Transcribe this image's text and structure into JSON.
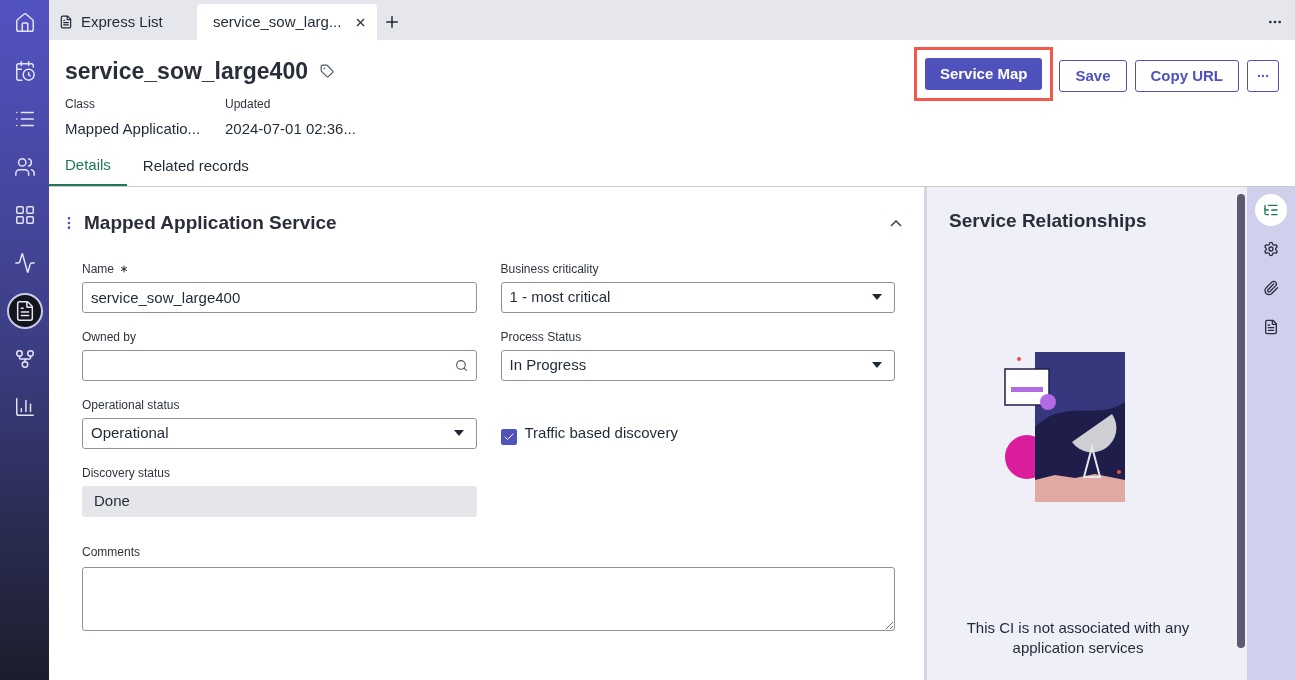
{
  "sidebar": {
    "items": [
      {
        "selected": false
      },
      {
        "selected": false
      },
      {
        "selected": false
      },
      {
        "selected": false
      },
      {
        "selected": false
      },
      {
        "selected": false
      },
      {
        "selected": true
      },
      {
        "selected": false
      },
      {
        "selected": false
      }
    ]
  },
  "tabs": [
    {
      "label": "Express List",
      "selected": false,
      "closable": false
    },
    {
      "label": "service_sow_larg...",
      "selected": true,
      "closable": true
    }
  ],
  "record": {
    "title": "service_sow_large400",
    "meta": [
      {
        "label": "Class",
        "value": "Mapped Applicatio..."
      },
      {
        "label": "Updated",
        "value": "2024-07-01 02:36..."
      }
    ]
  },
  "actions": [
    {
      "label": "Service Map",
      "primary": true,
      "highlighted": true
    },
    {
      "label": "Save",
      "primary": false,
      "highlighted": false
    },
    {
      "label": "Copy URL",
      "primary": false,
      "highlighted": false
    }
  ],
  "record_tabs": [
    {
      "label": "Details",
      "selected": true
    },
    {
      "label": "Related records",
      "selected": false
    }
  ],
  "section": {
    "title": "Mapped Application Service",
    "expanded": true,
    "left": [
      {
        "kind": "text",
        "label": "Name",
        "required": true,
        "value": "service_sow_large400"
      },
      {
        "kind": "lookup",
        "label": "Owned by",
        "required": false
      },
      {
        "kind": "select",
        "label": "Operational status",
        "required": false,
        "value": "Operational"
      },
      {
        "kind": "readonly",
        "label": "Discovery status",
        "required": false,
        "value": "Done"
      }
    ],
    "right": [
      {
        "kind": "select",
        "label": "Business criticality",
        "required": false,
        "value": "1 - most critical"
      },
      {
        "kind": "select",
        "label": "Process Status",
        "required": false,
        "value": "In Progress"
      },
      {
        "kind": "checkbox",
        "label": "Traffic based discovery",
        "checked": true
      }
    ],
    "comments": {
      "label": "Comments"
    }
  },
  "side_panel": {
    "title": "Service Relationships",
    "message": "This CI is not associated with any application services"
  },
  "rail": {
    "items": [
      {
        "selected": true
      },
      {
        "selected": false
      },
      {
        "selected": false
      },
      {
        "selected": false
      }
    ]
  }
}
